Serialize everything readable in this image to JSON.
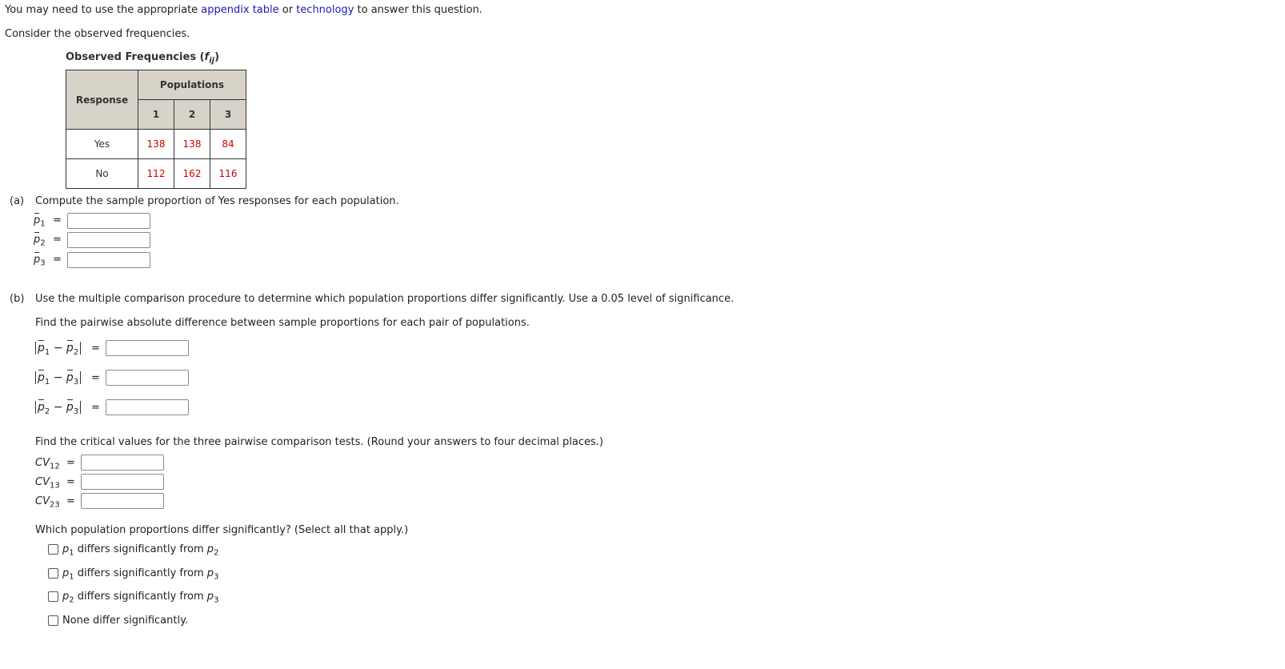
{
  "intro": {
    "prefix": "You may need to use the appropriate ",
    "link1": "appendix table",
    "middle": " or ",
    "link2": "technology",
    "suffix": " to answer this question."
  },
  "consider": "Consider the observed frequencies.",
  "table": {
    "caption": "Observed Frequencies (",
    "caption_var": "f",
    "caption_sub": "ij",
    "caption_end": ")",
    "response_header": "Response",
    "populations_header": "Populations",
    "population_labels": [
      "1",
      "2",
      "3"
    ],
    "rows": [
      {
        "label": "Yes",
        "values": [
          "138",
          "138",
          "84"
        ]
      },
      {
        "label": "No",
        "values": [
          "112",
          "162",
          "116"
        ]
      }
    ]
  },
  "part_a": {
    "label": "(a)",
    "text": "Compute the sample proportion of Yes responses for each population.",
    "fields": [
      {
        "var": "p",
        "sub": "1",
        "value": ""
      },
      {
        "var": "p",
        "sub": "2",
        "value": ""
      },
      {
        "var": "p",
        "sub": "3",
        "value": ""
      }
    ]
  },
  "part_b": {
    "label": "(b)",
    "text": "Use the multiple comparison procedure to determine which population proportions differ significantly. Use a 0.05 level of significance.",
    "diff_prompt": "Find the pairwise absolute difference between sample proportions for each pair of populations.",
    "diffs": [
      {
        "a": "1",
        "b": "2",
        "value": ""
      },
      {
        "a": "1",
        "b": "3",
        "value": ""
      },
      {
        "a": "2",
        "b": "3",
        "value": ""
      }
    ],
    "cv_prompt": "Find the critical values for the three pairwise comparison tests. (Round your answers to four decimal places.)",
    "cvs": [
      {
        "var": "CV",
        "sub": "12",
        "value": ""
      },
      {
        "var": "CV",
        "sub": "13",
        "value": ""
      },
      {
        "var": "CV",
        "sub": "23",
        "value": ""
      }
    ],
    "select_prompt": "Which population proportions differ significantly? (Select all that apply.)",
    "options": [
      {
        "a": "1",
        "text": " differs significantly from ",
        "b": "2",
        "checked": false
      },
      {
        "a": "1",
        "text": " differs significantly from ",
        "b": "3",
        "checked": false
      },
      {
        "a": "2",
        "text": " differs significantly from ",
        "b": "3",
        "checked": false
      }
    ],
    "none_option": "None differ significantly.",
    "eq": "="
  }
}
